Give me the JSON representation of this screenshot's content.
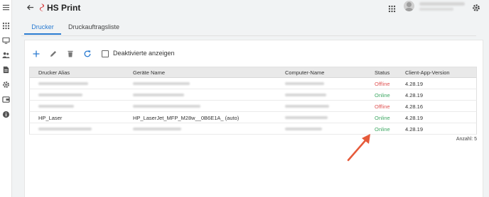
{
  "app": {
    "title": "HS Print"
  },
  "colors": {
    "accent": "#2a7bd1",
    "offline": "#e05555",
    "online": "#3fa864",
    "annotation_arrow": "#e65a3a"
  },
  "sidebar": {
    "icons": [
      "menu-icon",
      "apps-grid-icon",
      "monitor-icon",
      "users-icon",
      "document-icon",
      "settings-icon",
      "wallet-icon",
      "info-icon"
    ]
  },
  "tabs": [
    {
      "label": "Drucker",
      "active": true
    },
    {
      "label": "Druckauftragsliste",
      "active": false
    }
  ],
  "toolbar": {
    "icons": [
      "add-icon",
      "edit-icon",
      "delete-icon",
      "refresh-icon"
    ],
    "checkbox_label": "Deaktivierte anzeigen",
    "checkbox_checked": false
  },
  "table": {
    "headers": [
      "Drucker Alias",
      "Geräte Name",
      "Computer-Name",
      "Status",
      "Client-App-Version"
    ],
    "rows": [
      {
        "alias": "",
        "device": "",
        "computer": "",
        "status": "Offline",
        "version": "4.28.19",
        "blurred": true
      },
      {
        "alias": "",
        "device": "",
        "computer": "",
        "status": "Online",
        "version": "4.28.19",
        "blurred": true
      },
      {
        "alias": "",
        "device": "",
        "computer": "",
        "status": "Offline",
        "version": "4.28.16",
        "blurred": true
      },
      {
        "alias": "HP_Laser",
        "device": "HP_LaserJet_MFP_M28w__0B6E1A_ (auto)",
        "computer": "",
        "status": "Online",
        "version": "4.28.19",
        "blurred": false
      },
      {
        "alias": "",
        "device": "",
        "computer": "",
        "status": "Online",
        "version": "4.28.19",
        "blurred": true
      }
    ],
    "count_label": "Anzahl: 5"
  }
}
